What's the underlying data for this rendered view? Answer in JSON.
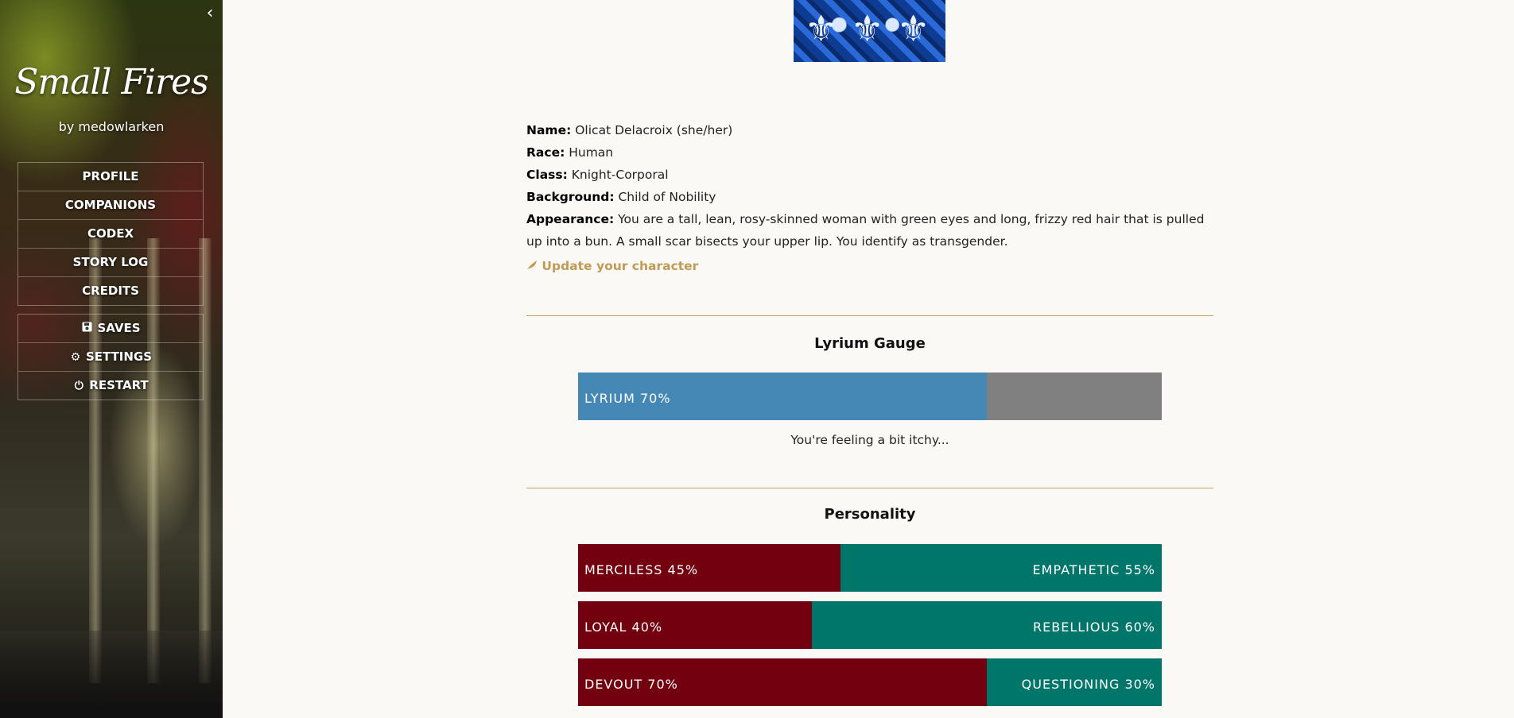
{
  "sidebar": {
    "collapse_icon": "chevron-left-icon",
    "title": "Small Fires",
    "author": "by medowlarken",
    "nav": [
      {
        "label": "PROFILE"
      },
      {
        "label": "COMPANIONS"
      },
      {
        "label": "CODEX"
      },
      {
        "label": "STORY LOG"
      },
      {
        "label": "CREDITS"
      }
    ],
    "system": [
      {
        "label": "SAVES",
        "icon": "floppy-disk-icon"
      },
      {
        "label": "SETTINGS",
        "icon": "gear-icon"
      },
      {
        "label": "RESTART",
        "icon": "power-icon"
      }
    ]
  },
  "profile": {
    "name_label": "Name:",
    "name_value": "Olicat Delacroix (she/her)",
    "race_label": "Race:",
    "race_value": "Human",
    "class_label": "Class:",
    "class_value": "Knight-Corporal",
    "background_label": "Background:",
    "background_value": "Child of Nobility",
    "appearance_label": "Appearance:",
    "appearance_value": "You are a tall, lean, rosy-skinned woman with green eyes and long, frizzy red hair that is pulled up into a bun. A small scar bisects your upper lip. You identify as transgender.",
    "update_link": "Update your character",
    "update_icon": "feather-icon"
  },
  "lyrium": {
    "title": "Lyrium Gauge",
    "label": "LYRIUM 70%",
    "percent": 70,
    "note": "You're feeling a bit itchy...",
    "fill_color": "#4587b5",
    "empty_color": "#808080"
  },
  "personality": {
    "title": "Personality",
    "left_color": "#73000f",
    "right_color": "#00756a",
    "bars": [
      {
        "left_label": "MERCILESS 45%",
        "right_label": "EMPATHETIC 55%",
        "left_percent": 45
      },
      {
        "left_label": "LOYAL 40%",
        "right_label": "REBELLIOUS 60%",
        "left_percent": 40
      },
      {
        "left_label": "DEVOUT 70%",
        "right_label": "QUESTIONING 30%",
        "left_percent": 70
      }
    ]
  },
  "colors": {
    "accent": "#c19a55",
    "page_background": "#faf9f5"
  }
}
